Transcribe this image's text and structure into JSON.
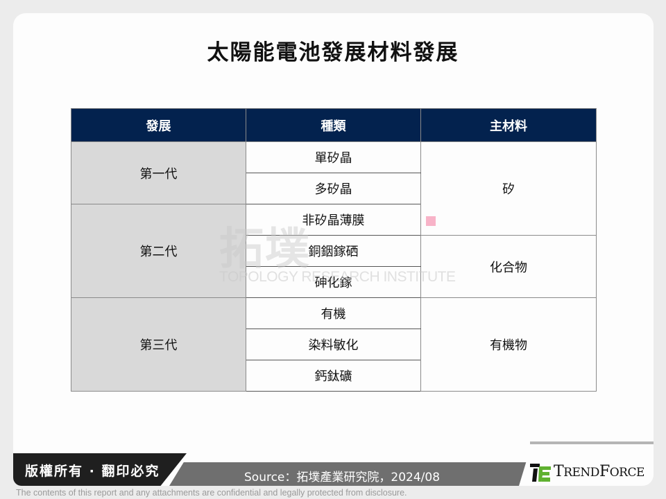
{
  "title": "太陽能電池發展材料發展",
  "watermark": {
    "cn": "拓墣",
    "en": "TOPOLOGY RESEARCH INSTITUTE"
  },
  "table": {
    "headers": [
      "發展",
      "種類",
      "主材料"
    ],
    "groups": [
      {
        "generation": "第一代",
        "types": [
          "單矽晶",
          "多矽晶"
        ]
      },
      {
        "generation": "第二代",
        "types": [
          "非矽晶薄膜",
          "銅銦鎵硒",
          "砷化鎵"
        ]
      },
      {
        "generation": "第三代",
        "types": [
          "有機",
          "染料敏化",
          "鈣鈦礦"
        ]
      }
    ],
    "materials": [
      {
        "label": "矽",
        "covers": [
          "單矽晶",
          "多矽晶",
          "非矽晶薄膜"
        ]
      },
      {
        "label": "化合物",
        "covers": [
          "銅銦鎵硒",
          "砷化鎵"
        ]
      },
      {
        "label": "有機物",
        "covers": [
          "有機",
          "染料敏化",
          "鈣鈦礦"
        ]
      }
    ],
    "colors": {
      "header_bg": "#03224e",
      "generation_bg": "#d9d9d9"
    }
  },
  "footer": {
    "copyright": "版權所有 · 翻印必究",
    "source": "Source：拓墣產業研究院，2024/08",
    "brand": "TrendForce",
    "disclaimer": "The contents of this report and any attachments are confidential and legally protected from disclosure."
  }
}
